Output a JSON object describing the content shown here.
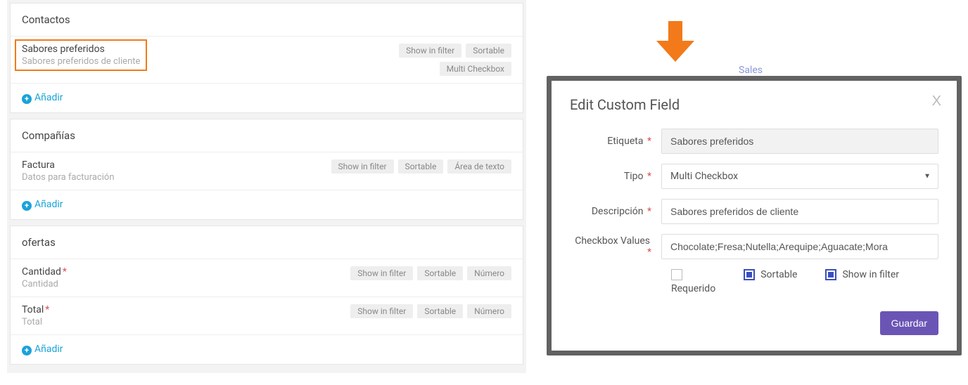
{
  "sections": [
    {
      "title": "Contactos",
      "fields": [
        {
          "title": "Sabores preferidos",
          "desc": "Sabores preferidos de cliente",
          "pills": [
            "Show in filter",
            "Sortable",
            "Multi Checkbox"
          ],
          "required": false,
          "highlight": true
        }
      ],
      "add_label": "Añadir"
    },
    {
      "title": "Compañías",
      "fields": [
        {
          "title": "Factura",
          "desc": "Datos para facturación",
          "pills": [
            "Show in filter",
            "Sortable",
            "Área de texto"
          ],
          "required": false,
          "highlight": false
        }
      ],
      "add_label": "Añadir"
    },
    {
      "title": "ofertas",
      "fields": [
        {
          "title": "Cantidad",
          "desc": "Cantidad",
          "pills": [
            "Show in filter",
            "Sortable",
            "Número"
          ],
          "required": true,
          "highlight": false
        },
        {
          "title": "Total",
          "desc": "Total",
          "pills": [
            "Show in filter",
            "Sortable",
            "Número"
          ],
          "required": true,
          "highlight": false
        }
      ],
      "add_label": "Añadir"
    }
  ],
  "bg_text": "Sales",
  "modal": {
    "title": "Edit Custom Field",
    "close_label": "X",
    "labels": {
      "etiqueta": "Etiqueta",
      "tipo": "Tipo",
      "descripcion": "Descripción",
      "checkbox_values": "Checkbox Values",
      "requerido": "Requerido",
      "sortable": "Sortable",
      "show_in_filter": "Show in filter"
    },
    "values": {
      "etiqueta": "Sabores preferidos",
      "tipo": "Multi Checkbox",
      "descripcion": "Sabores preferidos de cliente",
      "checkbox_values": "Chocolate;Fresa;Nutella;Arequipe;Aguacate;Mora",
      "requerido": false,
      "sortable": true,
      "show_in_filter": true
    },
    "save_label": "Guardar"
  }
}
